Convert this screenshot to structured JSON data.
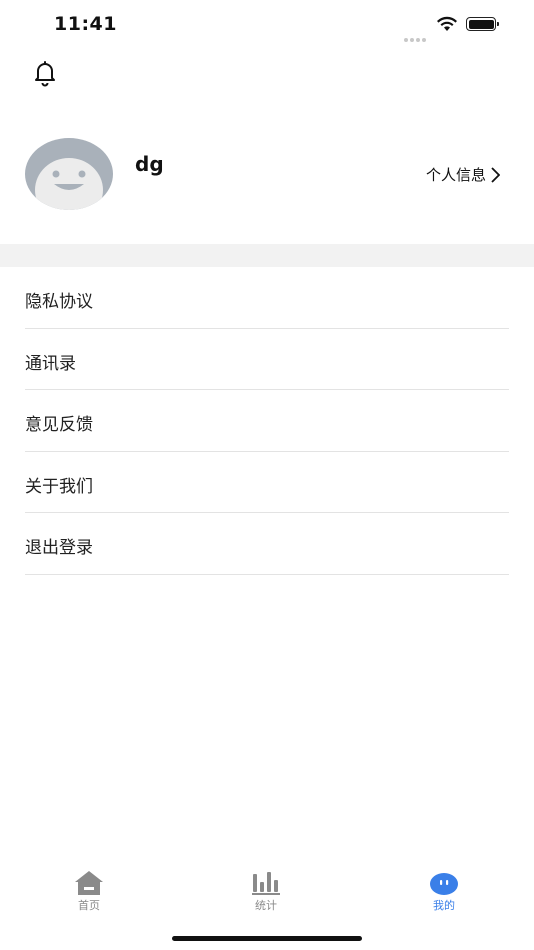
{
  "status_bar": {
    "time": "11:41"
  },
  "profile": {
    "username": "dg",
    "info_link_label": "个人信息"
  },
  "menu": {
    "items": [
      {
        "label": "隐私协议"
      },
      {
        "label": "通讯录"
      },
      {
        "label": "意见反馈"
      },
      {
        "label": "关于我们"
      },
      {
        "label": "退出登录"
      }
    ]
  },
  "tabbar": {
    "tabs": [
      {
        "label": "首页",
        "icon": "home-icon",
        "active": false
      },
      {
        "label": "统计",
        "icon": "bar-chart-icon",
        "active": false
      },
      {
        "label": "我的",
        "icon": "profile-face-icon",
        "active": true
      }
    ]
  },
  "colors": {
    "accent": "#3a7fe8",
    "tab_inactive": "#8a8a8a",
    "avatar_bg": "#a9b1ba",
    "band": "#f2f2f2"
  }
}
